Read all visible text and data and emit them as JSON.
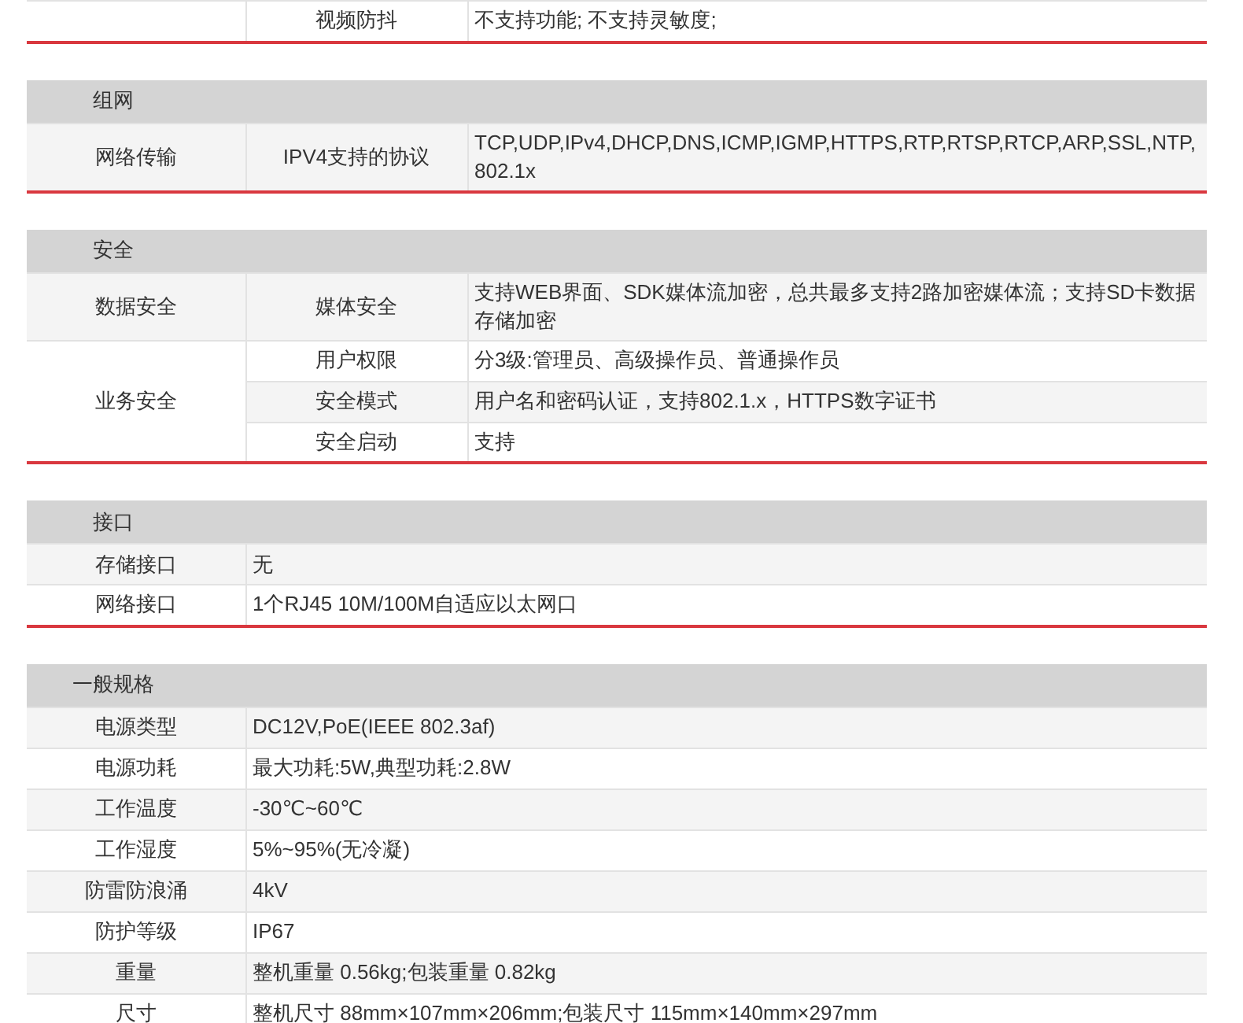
{
  "sections": [
    {
      "kind": "three_column",
      "groups": [
        {
          "rows": [
            {
              "label": "视频防抖",
              "value": "不支持功能; 不支持灵敏度;"
            }
          ]
        }
      ]
    },
    {
      "kind": "three_column",
      "title": "组网",
      "groups": [
        {
          "label": "网络传输",
          "rows": [
            {
              "label": "IPV4支持的协议",
              "value": "TCP,UDP,IPv4,DHCP,DNS,ICMP,IGMP,HTTPS,RTP,RTSP,RTCP,ARP,SSL,NTP,802.1x"
            }
          ]
        }
      ]
    },
    {
      "kind": "three_column",
      "title": "安全",
      "groups": [
        {
          "label": "数据安全",
          "rows": [
            {
              "label": "媒体安全",
              "value": "支持WEB界面、SDK媒体流加密，总共最多支持2路加密媒体流；支持SD卡数据存储加密"
            }
          ]
        },
        {
          "label": "业务安全",
          "rows": [
            {
              "label": "用户权限",
              "value": "分3级:管理员、高级操作员、普通操作员"
            },
            {
              "label": "安全模式",
              "value": "用户名和密码认证，支持802.1.x，HTTPS数字证书"
            },
            {
              "label": "安全启动",
              "value": "支持"
            }
          ]
        }
      ]
    },
    {
      "kind": "two_column",
      "title": "接口",
      "rows": [
        {
          "label": "存储接口",
          "value": "无"
        },
        {
          "label": "网络接口",
          "value": "1个RJ45 10M/100M自适应以太网口"
        }
      ]
    },
    {
      "kind": "two_column",
      "title": "一般规格",
      "rows": [
        {
          "label": "电源类型",
          "value": "DC12V,PoE(IEEE 802.3af)"
        },
        {
          "label": "电源功耗",
          "value": "最大功耗:5W,典型功耗:2.8W"
        },
        {
          "label": "工作温度",
          "value": "-30℃~60℃"
        },
        {
          "label": "工作湿度",
          "value": "5%~95%(无冷凝)"
        },
        {
          "label": "防雷防浪涌",
          "value": "4kV"
        },
        {
          "label": "防护等级",
          "value": "IP67"
        },
        {
          "label": "重量",
          "value": "整机重量 0.56kg;包装重量 0.82kg"
        },
        {
          "label": "尺寸",
          "value": "整机尺寸 88mm×107mm×206mm;包装尺寸 115mm×140mm×297mm"
        }
      ]
    }
  ]
}
